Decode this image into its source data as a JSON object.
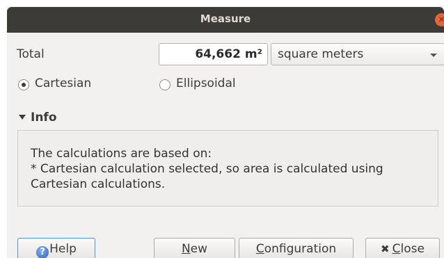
{
  "window": {
    "title": "Measure"
  },
  "total": {
    "label": "Total",
    "value": "64,662 m²",
    "unit_selected": "square meters"
  },
  "method": {
    "options": [
      {
        "label": "Cartesian",
        "checked": true
      },
      {
        "label": "Ellipsoidal",
        "checked": false
      }
    ]
  },
  "info": {
    "title": "Info",
    "expanded": true,
    "lines": [
      "The calculations are based on:",
      "* Cartesian calculation selected, so area is calculated using",
      "Cartesian calculations."
    ]
  },
  "buttons": {
    "help": "Help",
    "new": "New",
    "configuration": "Configuration",
    "close": "Close"
  },
  "colors": {
    "titlebar": "#3c3b37",
    "close_button": "#e9643b",
    "window_bg": "#f2f1f0",
    "focus_border": "#5b8fd0"
  }
}
